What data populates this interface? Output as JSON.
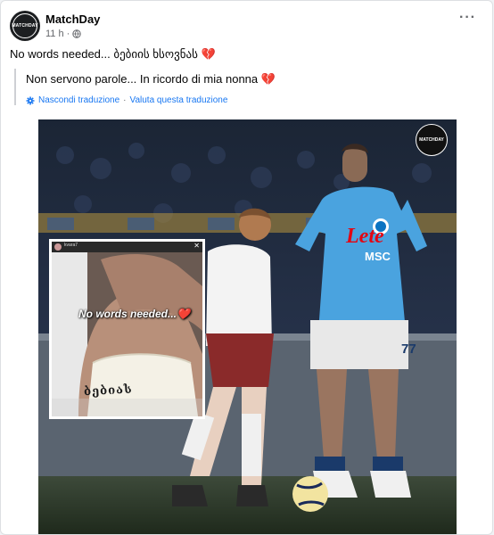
{
  "post": {
    "page_name": "MatchDay",
    "time": "11 h",
    "avatar_text": "MATCHDAY",
    "text": "No words needed... ბებიის ხსოვნას",
    "heart": "💔"
  },
  "translation": {
    "text": "Non servono parole... In ricordo di mia nonna",
    "heart": "💔",
    "hide_label": "Nascondi traduzione",
    "separator": "·",
    "rate_label": "Valuta questa traduzione"
  },
  "media": {
    "watermark": "MATCHDAY",
    "story_username": "kvara7",
    "story_caption": "No words needed...",
    "story_heart": "❤️",
    "wrist_text": "ბებიას",
    "jersey_sponsor": "Lete",
    "jersey_sub": "MSC",
    "jersey_number": "77"
  },
  "colors": {
    "link": "#1877f2",
    "napoli_blue": "#4aa3df",
    "heart": "#e0245e"
  }
}
